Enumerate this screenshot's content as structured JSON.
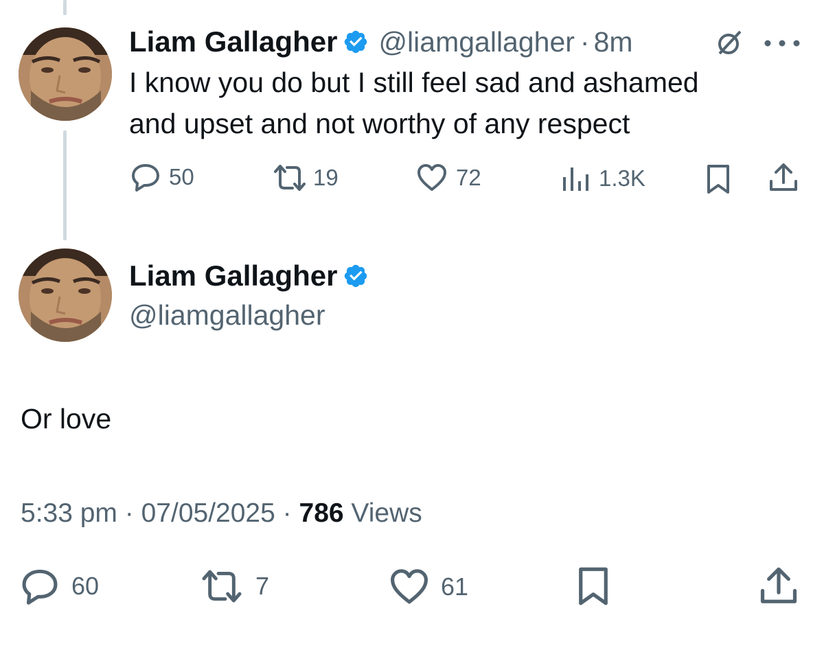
{
  "thread": {
    "parent": {
      "author_name": "Liam Gallagher",
      "handle": "@liamgallagher",
      "separator": "·",
      "time_ago": "8m",
      "text_line1": "I know you do but I still feel sad and ashamed",
      "text_line2": "and upset and not worthy of any respect",
      "stats": {
        "replies": "50",
        "reposts": "19",
        "likes": "72",
        "views": "1.3K"
      }
    },
    "main": {
      "author_name": "Liam Gallagher",
      "handle": "@liamgallagher",
      "text": "Or love",
      "time": "5:33 pm",
      "separator": "·",
      "date": "07/05/2025",
      "views_count": "786",
      "views_label": "Views",
      "stats": {
        "replies": "60",
        "reposts": "7",
        "likes": "61"
      }
    }
  },
  "colors": {
    "verified": "#1d9bf0",
    "muted_text": "#536471",
    "primary_text": "#0f1419",
    "thread_line": "#cfd9de"
  },
  "icons": [
    "verified-badge-icon",
    "grok-icon",
    "more-icon",
    "reply-icon",
    "repost-icon",
    "like-icon",
    "views-icon",
    "bookmark-icon",
    "share-icon"
  ]
}
